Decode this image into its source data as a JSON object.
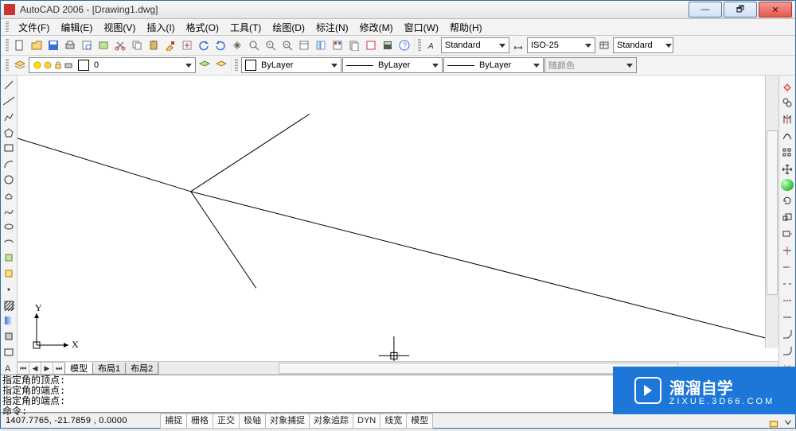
{
  "window": {
    "title": "AutoCAD 2006 - [Drawing1.dwg]",
    "min_glyph": "—",
    "max_glyph": "🗗",
    "close_glyph": "✕"
  },
  "menu": {
    "file": "文件(F)",
    "edit": "编辑(E)",
    "view": "视图(V)",
    "insert": "插入(I)",
    "format": "格式(O)",
    "tools": "工具(T)",
    "draw": "绘图(D)",
    "dimension": "标注(N)",
    "modify": "修改(M)",
    "window": "窗口(W)",
    "help": "帮助(H)"
  },
  "styles": {
    "text_style": "Standard",
    "dim_style": "ISO-25",
    "table_style": "Standard"
  },
  "layers": {
    "current": "0",
    "color_name": "ByLayer",
    "linetype": "ByLayer",
    "lineweight": "ByLayer",
    "plotstyle": "随颜色"
  },
  "tabs": {
    "model": "模型",
    "layout1": "布局1",
    "layout2": "布局2"
  },
  "cmd": {
    "l1": "指定角的顶点:",
    "l2": "指定角的端点:",
    "l3": "指定角的端点:",
    "prompt": "命令:"
  },
  "status": {
    "coords": "1407.7765, -21.7859 , 0.0000",
    "snap": "捕捉",
    "grid": "栅格",
    "ortho": "正交",
    "polar": "极轴",
    "osnap": "对象捕捉",
    "otrack": "对象追踪",
    "dyn": "DYN",
    "lwt": "线宽",
    "model": "模型"
  },
  "ucs": {
    "x": "X",
    "y": "Y"
  },
  "watermark": {
    "main": "溜溜自学",
    "sub": "ZIXUE.3D66.COM"
  }
}
